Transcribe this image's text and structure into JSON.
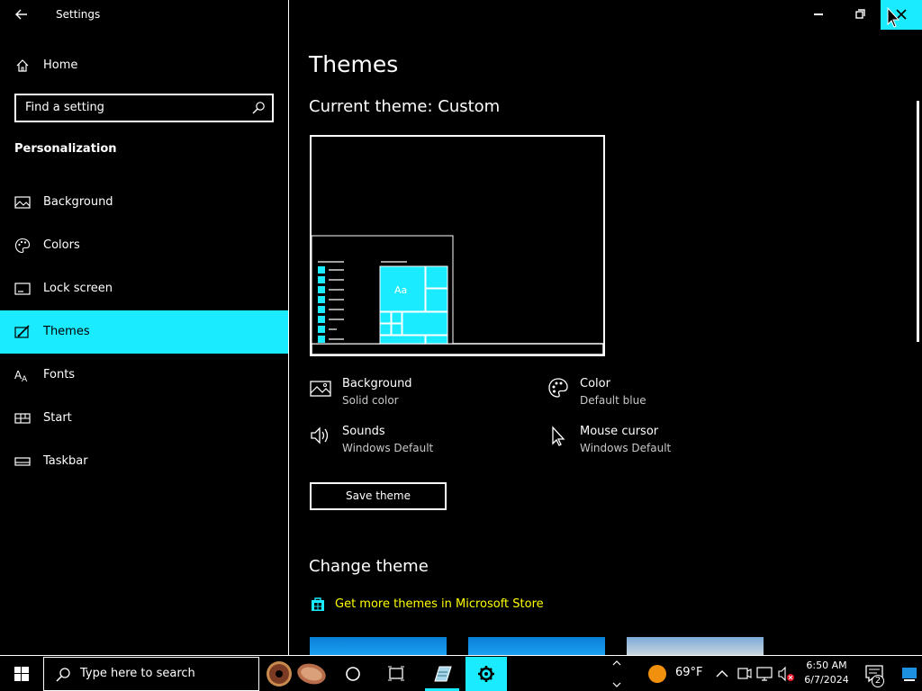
{
  "window": {
    "app_title": "Settings",
    "controls": [
      "minimize-icon",
      "restore-icon",
      "close-icon"
    ]
  },
  "sidebar": {
    "home_label": "Home",
    "search_placeholder": "Find a setting",
    "section_title": "Personalization",
    "items": [
      {
        "label": "Background",
        "icon": "picture-icon"
      },
      {
        "label": "Colors",
        "icon": "palette-icon"
      },
      {
        "label": "Lock screen",
        "icon": "lock-screen-icon"
      },
      {
        "label": "Themes",
        "icon": "themes-brush-icon",
        "selected": true
      },
      {
        "label": "Fonts",
        "icon": "fonts-icon"
      },
      {
        "label": "Start",
        "icon": "start-icon"
      },
      {
        "label": "Taskbar",
        "icon": "taskbar-icon"
      }
    ]
  },
  "main": {
    "title": "Themes",
    "current_theme": "Current theme: Custom",
    "preview_sample_text": "Aa",
    "attributes": {
      "background": {
        "title": "Background",
        "value": "Solid color"
      },
      "color": {
        "title": "Color",
        "value": "Default blue"
      },
      "sounds": {
        "title": "Sounds",
        "value": "Windows Default"
      },
      "cursor": {
        "title": "Mouse cursor",
        "value": "Windows Default"
      }
    },
    "save_button": "Save theme",
    "change_theme_title": "Change theme",
    "store_link": "Get more themes in Microsoft Store"
  },
  "taskbar": {
    "search_placeholder": "Type here to search",
    "weather": "69°F",
    "time": "6:50 AM",
    "date": "6/7/2024",
    "notification_count": "2"
  },
  "colors": {
    "accent": "#1aebff",
    "background": "#000000",
    "link": "#ffff00",
    "text": "#ffffff"
  }
}
